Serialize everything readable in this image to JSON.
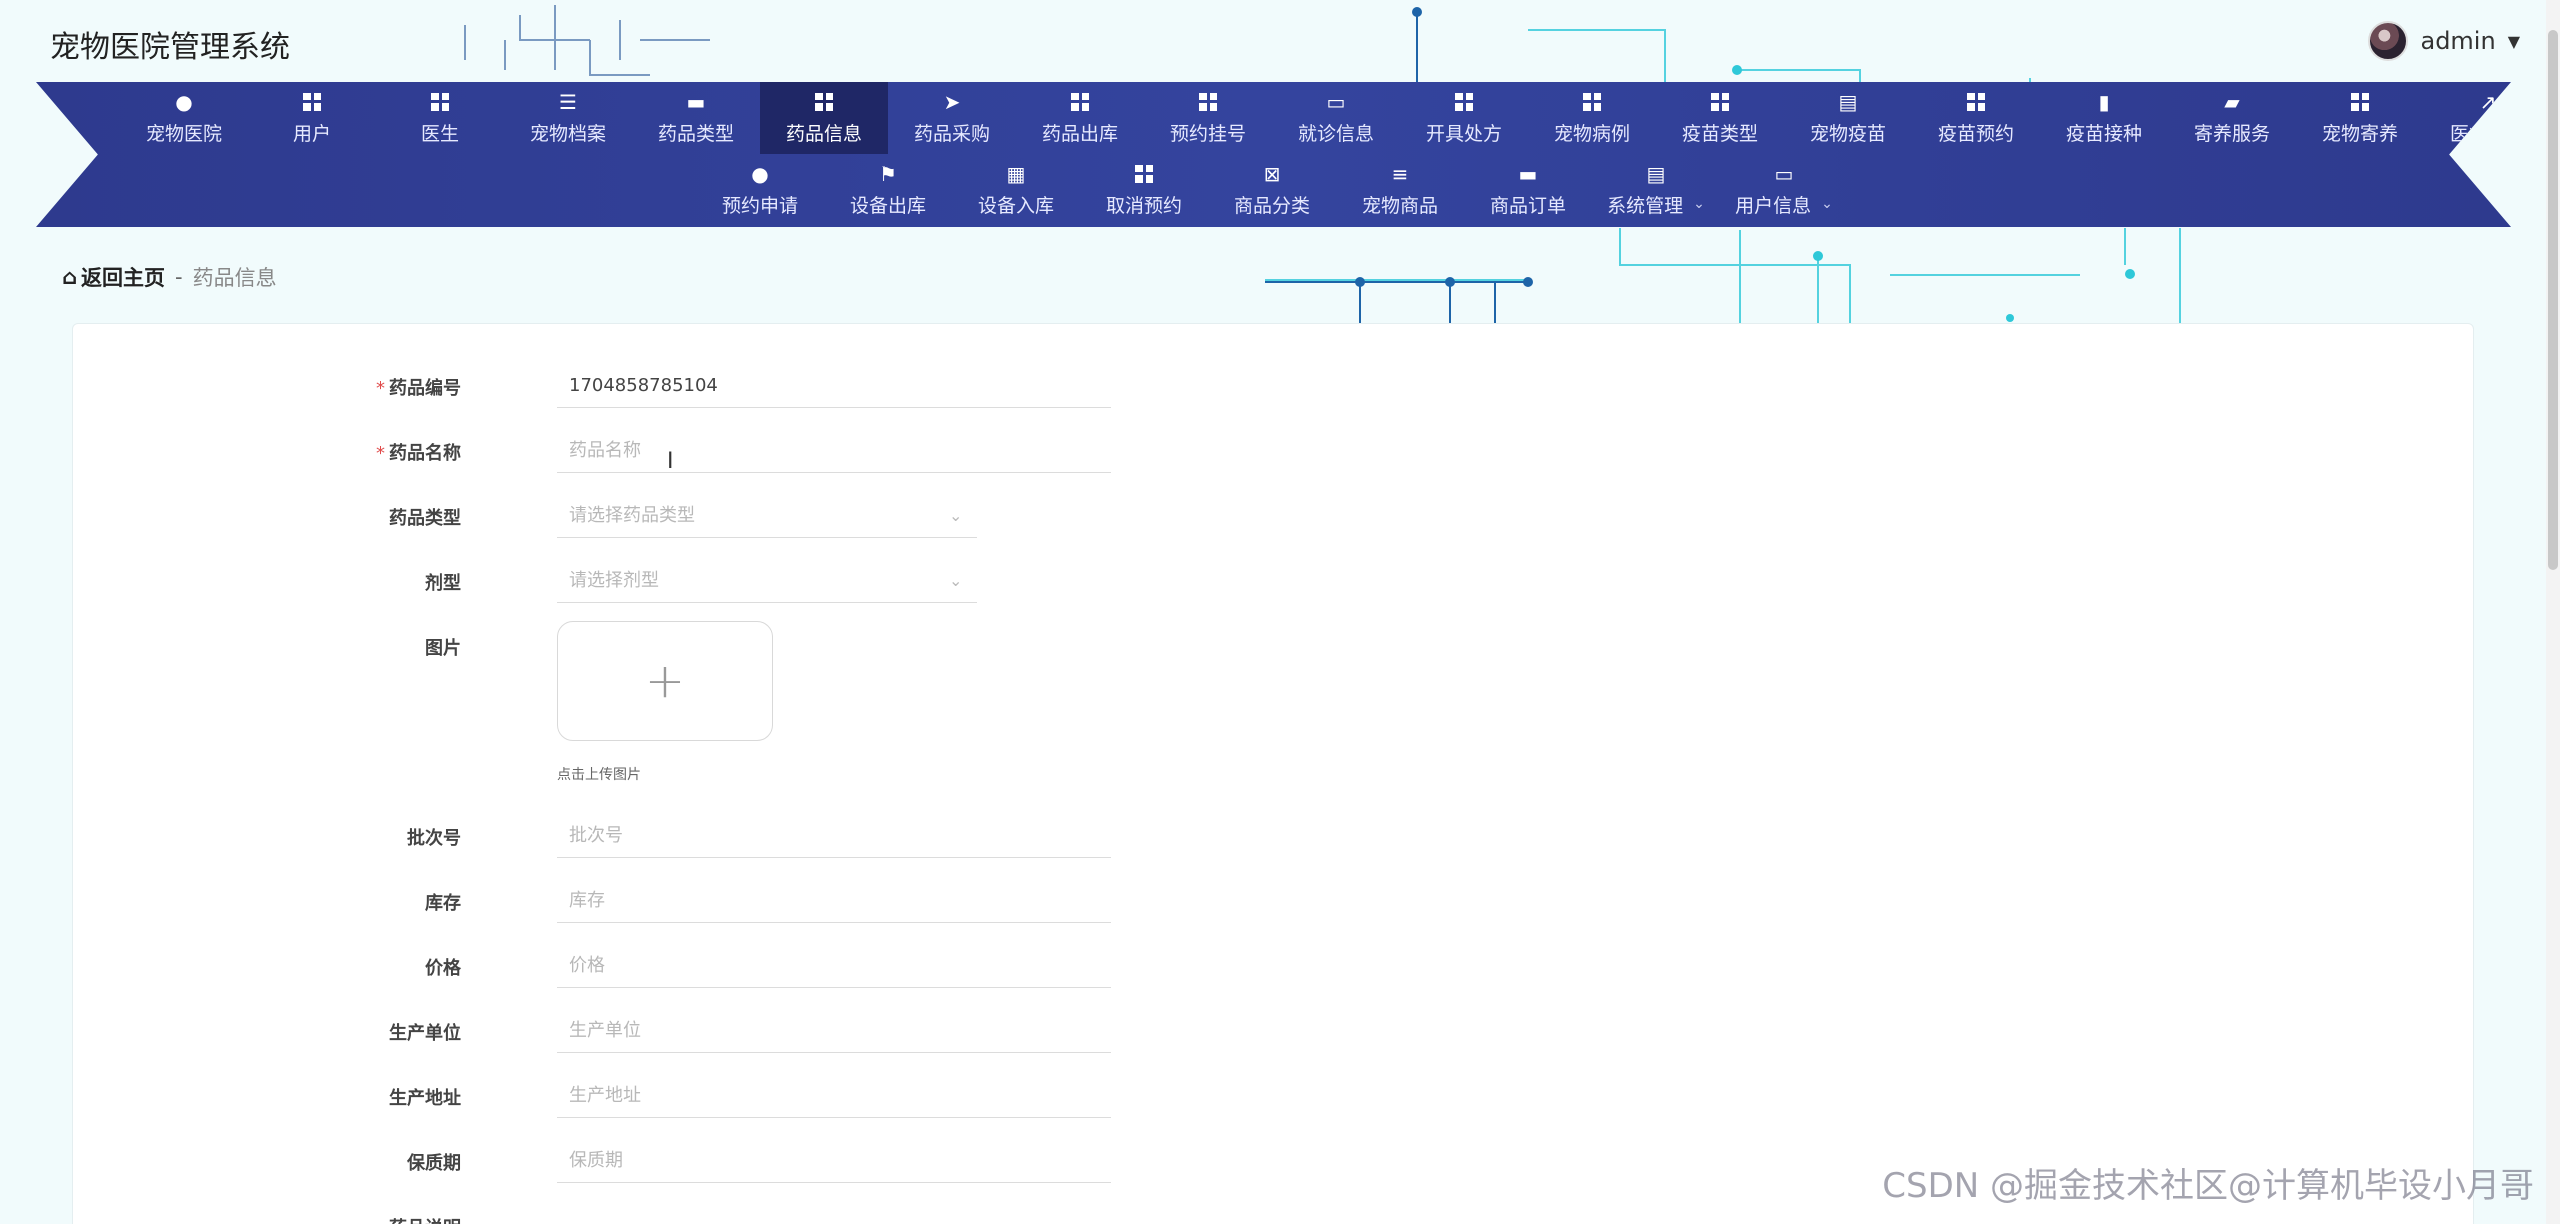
{
  "app": {
    "title": "宠物医院管理系统"
  },
  "user": {
    "name": "admin"
  },
  "nav": {
    "row1": [
      {
        "label": "宠物医院",
        "icon": "person-icon"
      },
      {
        "label": "用户",
        "icon": "grid-icon"
      },
      {
        "label": "医生",
        "icon": "grid-icon"
      },
      {
        "label": "宠物档案",
        "icon": "list-icon"
      },
      {
        "label": "药品类型",
        "icon": "bookmark-icon"
      },
      {
        "label": "药品信息",
        "icon": "grid-icon",
        "active": true
      },
      {
        "label": "药品采购",
        "icon": "send-icon"
      },
      {
        "label": "药品出库",
        "icon": "grid-icon"
      },
      {
        "label": "预约挂号",
        "icon": "grid-icon"
      },
      {
        "label": "就诊信息",
        "icon": "monitor-icon"
      },
      {
        "label": "开具处方",
        "icon": "grid-icon"
      },
      {
        "label": "宠物病例",
        "icon": "grid-icon"
      },
      {
        "label": "疫苗类型",
        "icon": "grid-icon"
      },
      {
        "label": "宠物疫苗",
        "icon": "clipboard-icon"
      },
      {
        "label": "疫苗预约",
        "icon": "grid-icon"
      },
      {
        "label": "疫苗接种",
        "icon": "bar-chart-icon"
      },
      {
        "label": "寄养服务",
        "icon": "wallet-icon"
      },
      {
        "label": "宠物寄养",
        "icon": "grid-icon"
      },
      {
        "label": "医疗设备",
        "icon": "trend-icon"
      }
    ],
    "row2": [
      {
        "label": "预约申请",
        "icon": "bulb-icon"
      },
      {
        "label": "设备出库",
        "icon": "flag-icon"
      },
      {
        "label": "设备入库",
        "icon": "grid9-icon"
      },
      {
        "label": "取消预约",
        "icon": "grid-icon"
      },
      {
        "label": "商品分类",
        "icon": "delete-doc-icon"
      },
      {
        "label": "宠物商品",
        "icon": "sliders-icon"
      },
      {
        "label": "商品订单",
        "icon": "chat-icon"
      },
      {
        "label": "系统管理",
        "icon": "clipboard-check-icon",
        "submenu": true
      },
      {
        "label": "用户信息",
        "icon": "card-icon",
        "submenu": true
      }
    ]
  },
  "breadcrumb": {
    "home": "返回主页",
    "separator": "-",
    "current": "药品信息"
  },
  "form": {
    "code": {
      "label": "药品编号",
      "value": "1704858785104"
    },
    "name": {
      "label": "药品名称",
      "placeholder": "药品名称"
    },
    "type": {
      "label": "药品类型",
      "placeholder": "请选择药品类型"
    },
    "dosage": {
      "label": "剂型",
      "placeholder": "请选择剂型"
    },
    "image": {
      "label": "图片",
      "tip": "点击上传图片"
    },
    "batch": {
      "label": "批次号",
      "placeholder": "批次号"
    },
    "stock": {
      "label": "库存",
      "placeholder": "库存"
    },
    "price": {
      "label": "价格",
      "placeholder": "价格"
    },
    "maker": {
      "label": "生产单位",
      "placeholder": "生产单位"
    },
    "address": {
      "label": "生产地址",
      "placeholder": "生产地址"
    },
    "shelf": {
      "label": "保质期",
      "placeholder": "保质期"
    },
    "desc": {
      "label": "药品说明"
    }
  },
  "watermark": "CSDN @掘金技术社区@计算机毕设小月哥",
  "colors": {
    "nav_bg": "#2e3a8e",
    "nav_active": "#1f2766",
    "required": "#e04a4a"
  }
}
